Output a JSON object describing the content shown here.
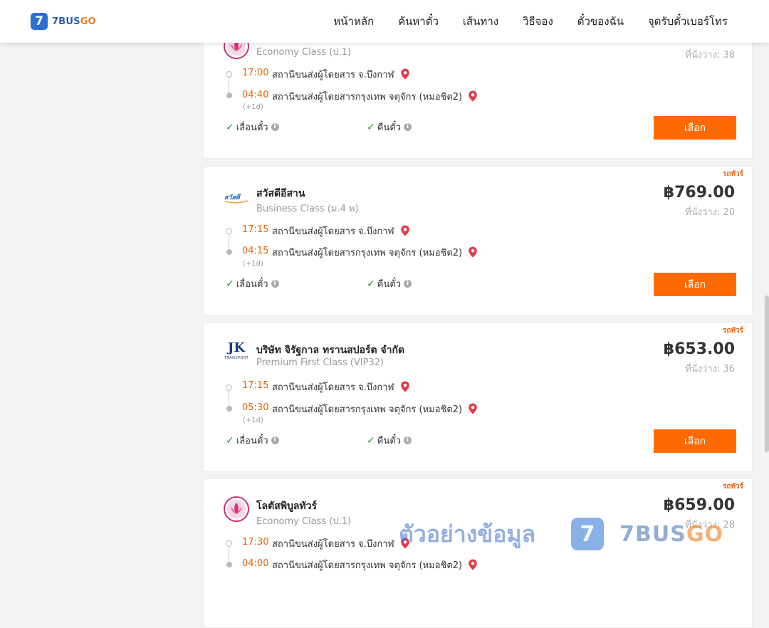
{
  "header": {
    "logo_digit": "7",
    "logo_text_a": "7BUS",
    "logo_text_b": "GO",
    "nav": [
      "หน้าหลัก",
      "ค้นหาตั๋ว",
      "เส้นทาง",
      "วิธีจอง",
      "ตั๋วของฉัน",
      "จุดรับตั๋วเบอร์โทร"
    ]
  },
  "cards": [
    {
      "tag": "",
      "operator": "",
      "class": "Economy Class (ป.1)",
      "price": "",
      "seats": "ที่นั่งว่าง: 38",
      "depart_time": "17:00",
      "depart_station": "สถานีขนส่งผู้โดยสาร จ.บึงกาฬ",
      "arrive_time": "04:40",
      "arrive_station": "สถานีขนส่งผู้โดยสารกรุงเทพ จตุจักร (หมอชิต2)",
      "plus_day": "(+1d)",
      "reschedule": "เลื่อนตั๋ว",
      "refund": "คืนตั๋ว",
      "button": "เลือก",
      "logo": "lotus-logo"
    },
    {
      "tag": "รถทัวร์",
      "operator": "สวัสดีอีสาน",
      "class": "Business Class (ม.4 พ)",
      "price": "฿769.00",
      "seats": "ที่นั่งว่าง: 20",
      "depart_time": "17:15",
      "depart_station": "สถานีขนส่งผู้โดยสาร จ.บึงกาฬ",
      "arrive_time": "04:15",
      "arrive_station": "สถานีขนส่งผู้โดยสารกรุงเทพ จตุจักร (หมอชิต2)",
      "plus_day": "(+1d)",
      "reschedule": "เลื่อนตั๋ว",
      "refund": "คืนตั๋ว",
      "button": "เลือก",
      "logo": "sawasdee-logo"
    },
    {
      "tag": "รถทัวร์",
      "operator": "บริษัท จิรัฐกาล ทรานสปอร์ต จำกัด",
      "class": "Premium First Class (VIP32)",
      "price": "฿653.00",
      "seats": "ที่นั่งว่าง: 36",
      "depart_time": "17:15",
      "depart_station": "สถานีขนส่งผู้โดยสาร จ.บึงกาฬ",
      "arrive_time": "05:30",
      "arrive_station": "สถานีขนส่งผู้โดยสารกรุงเทพ จตุจักร (หมอชิต2)",
      "plus_day": "(+1d)",
      "reschedule": "เลื่อนตั๋ว",
      "refund": "คืนตั๋ว",
      "button": "เลือก",
      "logo": "jk-transport-logo",
      "logo_text": "JK",
      "logo_subtext": "TRANSPORT"
    },
    {
      "tag": "รถทัวร์",
      "operator": "โลตัสพิบูลทัวร์",
      "class": "Economy Class (ป.1)",
      "price": "฿659.00",
      "seats": "ที่นั่งว่าง: 28",
      "depart_time": "17:30",
      "depart_station": "สถานีขนส่งผู้โดยสาร จ.บึงกาฬ",
      "arrive_time": "04:00",
      "arrive_station": "สถานีขนส่งผู้โดยสารกรุงเทพ จตุจักร (หมอชิต2)",
      "plus_day": "",
      "reschedule": "",
      "refund": "",
      "button": "",
      "logo": "lotus-logo"
    }
  ],
  "watermark": {
    "text": "ตัวอย่างข้อมูล",
    "digit": "7",
    "brand_a": "7BUS",
    "brand_b": "GO"
  },
  "colors": {
    "accent": "#ff6a00",
    "time": "#e8620a",
    "brand_blue": "#2a6fd6",
    "check": "#2a9a3a",
    "pin": "#e63946"
  }
}
